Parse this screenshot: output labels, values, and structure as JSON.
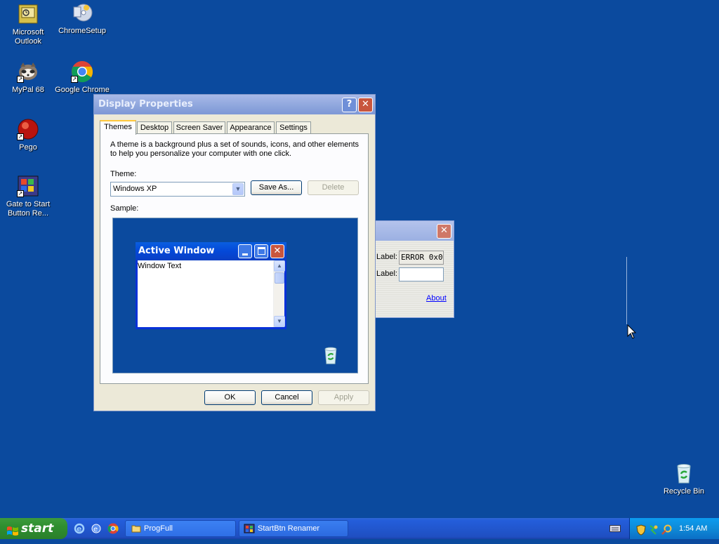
{
  "desktop": {
    "icons": [
      {
        "label": "Microsoft Outlook",
        "icon": "outlook-icon"
      },
      {
        "label": "ChromeSetup",
        "icon": "installer-icon"
      },
      {
        "label": "MyPal 68",
        "icon": "mypal-icon"
      },
      {
        "label": "Google Chrome",
        "icon": "chrome-icon"
      },
      {
        "label": "Pego",
        "icon": "pego-icon"
      },
      {
        "label": "Gate to Start Button Re...",
        "icon": "gate-start-icon"
      },
      {
        "label": "Recycle Bin",
        "icon": "recycle-bin-icon"
      }
    ]
  },
  "display_properties": {
    "title": "Display Properties",
    "help_glyph": "?",
    "close_glyph": "✕",
    "tabs": [
      "Themes",
      "Desktop",
      "Screen Saver",
      "Appearance",
      "Settings"
    ],
    "description": "A theme is a background plus a set of sounds, icons, and other elements to help you personalize your computer with one click.",
    "theme_label": "Theme:",
    "theme_value": "Windows XP",
    "save_as": "Save As...",
    "delete": "Delete",
    "sample_label": "Sample:",
    "sample_window": {
      "title": "Active Window",
      "text": "Window Text"
    },
    "ok": "OK",
    "cancel": "Cancel",
    "apply": "Apply"
  },
  "back_window": {
    "label1": "Label:",
    "value1": "ERROR 0x0",
    "label2": "Label:",
    "value2": "",
    "about": "About",
    "close_glyph": "✕"
  },
  "taskbar": {
    "start": "start",
    "tasks": [
      "ProgFull",
      "StartBtn Renamer"
    ],
    "clock": "1:54 AM"
  },
  "colors": {
    "desktop": "#0b4a9e",
    "taskbar": "#245edb",
    "start_button": "#2f8f2f",
    "active_title": "#0448d8"
  }
}
